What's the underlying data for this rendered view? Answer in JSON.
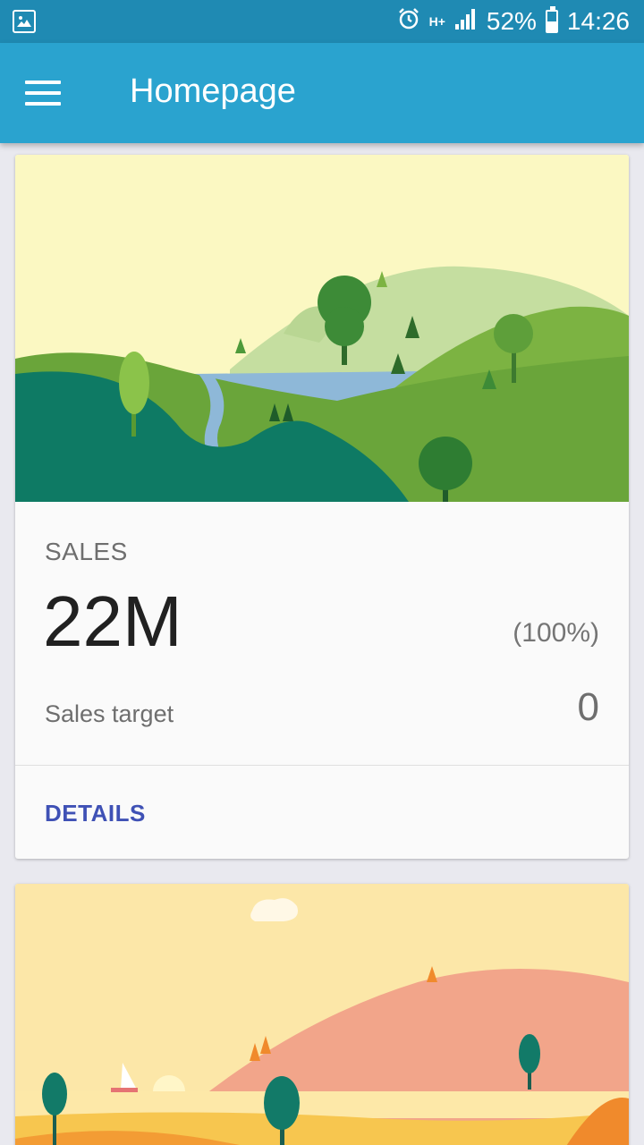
{
  "status_bar": {
    "network": "H+",
    "battery_percent_text": "52%",
    "battery_level": 0.52,
    "time": "14:26",
    "icons": [
      "gallery-icon",
      "alarm-icon",
      "network-h-plus-icon",
      "signal-icon",
      "battery-icon"
    ]
  },
  "app_bar": {
    "title": "Homepage",
    "menu_icon": "hamburger-menu-icon"
  },
  "sales_card": {
    "label": "SALES",
    "value": "22M",
    "percent": "(100%)",
    "target_label": "Sales target",
    "target_value": "0",
    "action": "DETAILS"
  },
  "colors": {
    "status_bar": "#1f8ab3",
    "app_bar": "#2aa3cf",
    "accent": "#3f51b5",
    "background": "#e9e9ef"
  }
}
